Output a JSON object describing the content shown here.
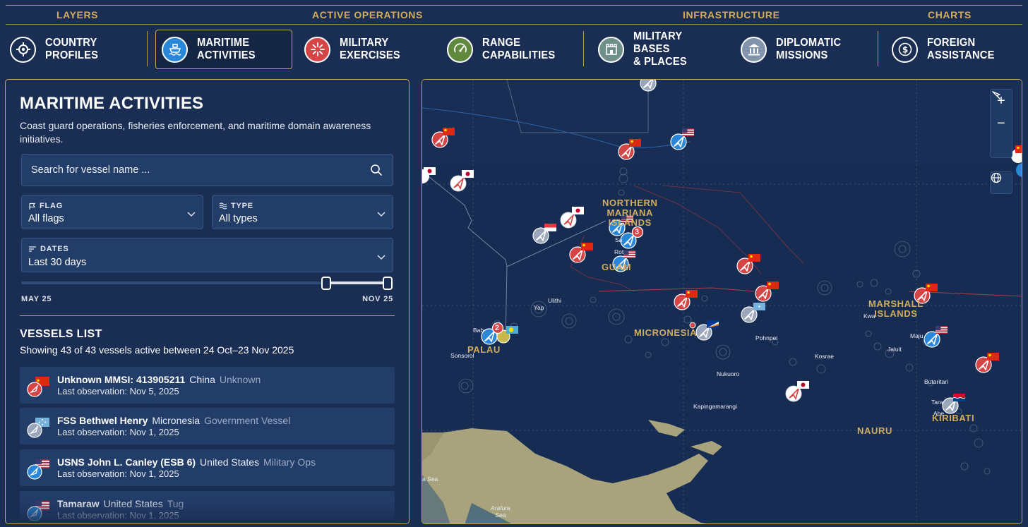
{
  "nav": {
    "sections": [
      "LAYERS",
      "ACTIVE OPERATIONS",
      "INFRASTRUCTURE",
      "CHARTS"
    ],
    "buttons": [
      {
        "label": "COUNTRY\nPROFILES",
        "icon": "crosshair-icon",
        "color": "#1a2d52"
      },
      {
        "label": "MARITIME\nACTIVITIES",
        "icon": "ship-icon",
        "color": "#2a86d8",
        "active": true
      },
      {
        "label": "MILITARY\nEXERCISES",
        "icon": "burst-icon",
        "color": "#d64545"
      },
      {
        "label": "RANGE\nCAPABILITIES",
        "icon": "gauge-icon",
        "color": "#5f8a3d"
      },
      {
        "label": "MILITARY BASES\n& PLACES",
        "icon": "base-icon",
        "color": "#6f8f8a"
      },
      {
        "label": "DIPLOMATIC\nMISSIONS",
        "icon": "embassy-icon",
        "color": "#8294ab"
      },
      {
        "label": "FOREIGN\nASSISTANCE",
        "icon": "dollar-icon",
        "color": "#1a2d52"
      }
    ]
  },
  "panel": {
    "title": "MARITIME ACTIVITIES",
    "description": "Coast guard operations, fisheries enforcement, and maritime domain awareness initiatives.",
    "search_placeholder": "Search for vessel name ...",
    "flag_label": "FLAG",
    "flag_value": "All flags",
    "type_label": "TYPE",
    "type_value": "All types",
    "dates_label": "DATES",
    "dates_value": "Last 30 days",
    "range_start": "MAY 25",
    "range_end": "NOV 25",
    "range_selected": [
      0.82,
      0.985
    ],
    "vessels_title": "VESSELS LIST",
    "vessels_summary": "Showing 43 of 43 vessels active between 24 Oct–23 Nov 2025",
    "vessels": [
      {
        "name": "Unknown MMSI: 413905211",
        "country": "China",
        "type": "Unknown",
        "last": "Last observation: Nov 5, 2025",
        "flag": "cn",
        "color": "#d64545"
      },
      {
        "name": "FSS Bethwel Henry",
        "country": "Micronesia",
        "type": "Government Vessel",
        "last": "Last observation: Nov 1, 2025",
        "flag": "fm",
        "color": "#9aa7ba"
      },
      {
        "name": "USNS John L. Canley (ESB 6)",
        "country": "United States",
        "type": "Military Ops",
        "last": "Last observation: Nov 1, 2025",
        "flag": "us",
        "color": "#2a86d8"
      },
      {
        "name": "Tamaraw",
        "country": "United States",
        "type": "Tug",
        "last": "Last observation: Nov 1, 2025",
        "flag": "us",
        "color": "#2a86d8"
      }
    ]
  },
  "map": {
    "region_labels": [
      "NORTHERN MARIANA ISLANDS",
      "GUAM",
      "MICRONESIA",
      "PALAU",
      "MARSHALL ISLANDS",
      "NAURU",
      "KIRIBATI"
    ],
    "northern_mariana": "NORTHERN\nMARIANA\nISLANDS",
    "guam": "GUAM",
    "micronesia": "MICRONESIA",
    "palau": "PALAU",
    "marshall": "MARSHALL\nISLANDS",
    "nauru": "NAURU",
    "kiribati": "KIRIBATI",
    "places": {
      "yap": "Yap",
      "ulithi": "Ulithi",
      "sonsorol": "Sonsorol",
      "pohnpei": "Pohnpei",
      "kosrae": "Kosrae",
      "nukuoro": "Nukuoro",
      "kapinga": "Kapingamarangi",
      "kwa": "Kwa",
      "majuro": "Maju",
      "jaluit": "Jaluit",
      "butaritari": "Butaritari",
      "tarawa": "Tara",
      "abemama": "Abe",
      "arafura": "Arafura\nSea",
      "sea": "a Sea",
      "babeldaob": "Bab",
      "saipan": "Sa",
      "rota": "Rot"
    },
    "clusters": {
      "palau": "2",
      "marianas": "3"
    },
    "zoom_in": "+",
    "zoom_out": "−",
    "colors": {
      "china": "#d64545",
      "us": "#2a86d8",
      "japan": "#ffffff",
      "other": "#9aa7ba",
      "land": "#a8a37d"
    }
  }
}
